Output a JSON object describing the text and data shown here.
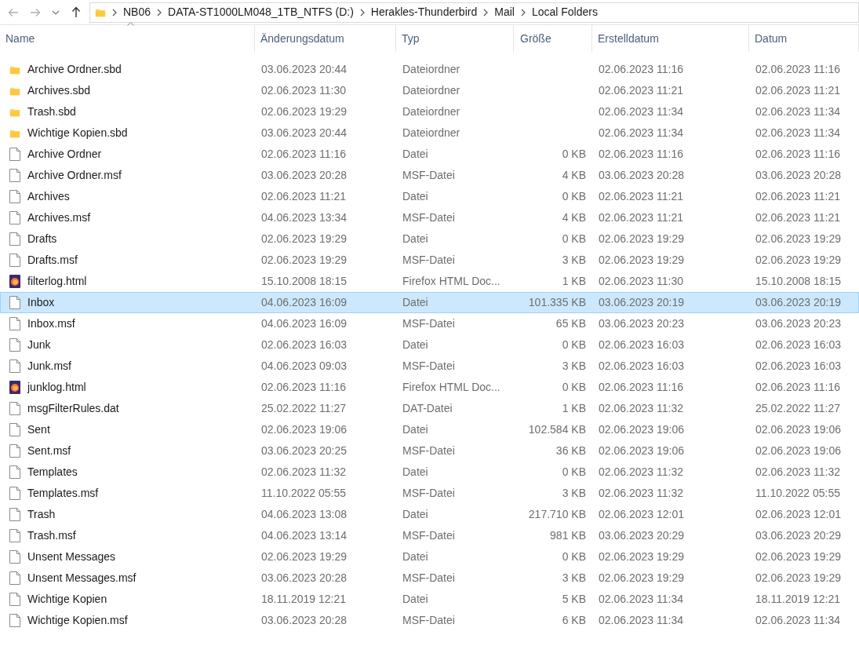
{
  "address_bar": {
    "breadcrumbs": [
      "NB06",
      "DATA-ST1000LM048_1TB_NTFS (D:)",
      "Herakles-Thunderbird",
      "Mail",
      "Local Folders"
    ]
  },
  "table": {
    "columns": [
      {
        "label": "Name",
        "sorted": true
      },
      {
        "label": "Änderungsdatum",
        "sorted": false
      },
      {
        "label": "Typ",
        "sorted": false
      },
      {
        "label": "Größe",
        "sorted": false
      },
      {
        "label": "Erstelldatum",
        "sorted": false
      },
      {
        "label": "Datum",
        "sorted": false
      }
    ],
    "rows": [
      {
        "kind": "folder",
        "selected": false,
        "cells": [
          "Archive Ordner.sbd",
          "03.06.2023 20:44",
          "Dateiordner",
          "",
          "02.06.2023 11:16",
          "02.06.2023 11:16"
        ]
      },
      {
        "kind": "folder",
        "selected": false,
        "cells": [
          "Archives.sbd",
          "02.06.2023 11:30",
          "Dateiordner",
          "",
          "02.06.2023 11:21",
          "02.06.2023 11:21"
        ]
      },
      {
        "kind": "folder",
        "selected": false,
        "cells": [
          "Trash.sbd",
          "02.06.2023 19:29",
          "Dateiordner",
          "",
          "02.06.2023 11:34",
          "02.06.2023 11:34"
        ]
      },
      {
        "kind": "folder",
        "selected": false,
        "cells": [
          "Wichtige Kopien.sbd",
          "03.06.2023 20:44",
          "Dateiordner",
          "",
          "02.06.2023 11:34",
          "02.06.2023 11:34"
        ]
      },
      {
        "kind": "file",
        "selected": false,
        "cells": [
          "Archive Ordner",
          "02.06.2023 11:16",
          "Datei",
          "0 KB",
          "02.06.2023 11:16",
          "02.06.2023 11:16"
        ]
      },
      {
        "kind": "file",
        "selected": false,
        "cells": [
          "Archive Ordner.msf",
          "03.06.2023 20:28",
          "MSF-Datei",
          "4 KB",
          "03.06.2023 20:28",
          "03.06.2023 20:28"
        ]
      },
      {
        "kind": "file",
        "selected": false,
        "cells": [
          "Archives",
          "02.06.2023 11:21",
          "Datei",
          "0 KB",
          "02.06.2023 11:21",
          "02.06.2023 11:21"
        ]
      },
      {
        "kind": "file",
        "selected": false,
        "cells": [
          "Archives.msf",
          "04.06.2023 13:34",
          "MSF-Datei",
          "4 KB",
          "02.06.2023 11:21",
          "02.06.2023 11:21"
        ]
      },
      {
        "kind": "file",
        "selected": false,
        "cells": [
          "Drafts",
          "02.06.2023 19:29",
          "Datei",
          "0 KB",
          "02.06.2023 19:29",
          "02.06.2023 19:29"
        ]
      },
      {
        "kind": "file",
        "selected": false,
        "cells": [
          "Drafts.msf",
          "02.06.2023 19:29",
          "MSF-Datei",
          "3 KB",
          "02.06.2023 19:29",
          "02.06.2023 19:29"
        ]
      },
      {
        "kind": "web",
        "selected": false,
        "cells": [
          "filterlog.html",
          "15.10.2008 18:15",
          "Firefox HTML Doc...",
          "1 KB",
          "02.06.2023 11:30",
          "15.10.2008 18:15"
        ]
      },
      {
        "kind": "file",
        "selected": true,
        "cells": [
          "Inbox",
          "04.06.2023 16:09",
          "Datei",
          "101.335 KB",
          "03.06.2023 20:19",
          "03.06.2023 20:19"
        ]
      },
      {
        "kind": "file",
        "selected": false,
        "cells": [
          "Inbox.msf",
          "04.06.2023 16:09",
          "MSF-Datei",
          "65 KB",
          "03.06.2023 20:23",
          "03.06.2023 20:23"
        ]
      },
      {
        "kind": "file",
        "selected": false,
        "cells": [
          "Junk",
          "02.06.2023 16:03",
          "Datei",
          "0 KB",
          "02.06.2023 16:03",
          "02.06.2023 16:03"
        ]
      },
      {
        "kind": "file",
        "selected": false,
        "cells": [
          "Junk.msf",
          "04.06.2023 09:03",
          "MSF-Datei",
          "3 KB",
          "02.06.2023 16:03",
          "02.06.2023 16:03"
        ]
      },
      {
        "kind": "web",
        "selected": false,
        "cells": [
          "junklog.html",
          "02.06.2023 11:16",
          "Firefox HTML Doc...",
          "0 KB",
          "02.06.2023 11:16",
          "02.06.2023 11:16"
        ]
      },
      {
        "kind": "file",
        "selected": false,
        "cells": [
          "msgFilterRules.dat",
          "25.02.2022 11:27",
          "DAT-Datei",
          "1 KB",
          "02.06.2023 11:32",
          "25.02.2022 11:27"
        ]
      },
      {
        "kind": "file",
        "selected": false,
        "cells": [
          "Sent",
          "02.06.2023 19:06",
          "Datei",
          "102.584 KB",
          "02.06.2023 19:06",
          "02.06.2023 19:06"
        ]
      },
      {
        "kind": "file",
        "selected": false,
        "cells": [
          "Sent.msf",
          "03.06.2023 20:25",
          "MSF-Datei",
          "36 KB",
          "02.06.2023 19:06",
          "02.06.2023 19:06"
        ]
      },
      {
        "kind": "file",
        "selected": false,
        "cells": [
          "Templates",
          "02.06.2023 11:32",
          "Datei",
          "0 KB",
          "02.06.2023 11:32",
          "02.06.2023 11:32"
        ]
      },
      {
        "kind": "file",
        "selected": false,
        "cells": [
          "Templates.msf",
          "11.10.2022 05:55",
          "MSF-Datei",
          "3 KB",
          "02.06.2023 11:32",
          "11.10.2022 05:55"
        ]
      },
      {
        "kind": "file",
        "selected": false,
        "cells": [
          "Trash",
          "04.06.2023 13:08",
          "Datei",
          "217.710 KB",
          "02.06.2023 12:01",
          "02.06.2023 12:01"
        ]
      },
      {
        "kind": "file",
        "selected": false,
        "cells": [
          "Trash.msf",
          "04.06.2023 13:14",
          "MSF-Datei",
          "981 KB",
          "03.06.2023 20:29",
          "03.06.2023 20:29"
        ]
      },
      {
        "kind": "file",
        "selected": false,
        "cells": [
          "Unsent Messages",
          "02.06.2023 19:29",
          "Datei",
          "0 KB",
          "02.06.2023 19:29",
          "02.06.2023 19:29"
        ]
      },
      {
        "kind": "file",
        "selected": false,
        "cells": [
          "Unsent Messages.msf",
          "03.06.2023 20:28",
          "MSF-Datei",
          "3 KB",
          "02.06.2023 19:29",
          "02.06.2023 19:29"
        ]
      },
      {
        "kind": "file",
        "selected": false,
        "cells": [
          "Wichtige Kopien",
          "18.11.2019 12:21",
          "Datei",
          "5 KB",
          "02.06.2023 11:34",
          "18.11.2019 12:21"
        ]
      },
      {
        "kind": "file",
        "selected": false,
        "cells": [
          "Wichtige Kopien.msf",
          "03.06.2023 20:28",
          "MSF-Datei",
          "6 KB",
          "02.06.2023 11:34",
          "02.06.2023 11:34"
        ]
      }
    ]
  }
}
